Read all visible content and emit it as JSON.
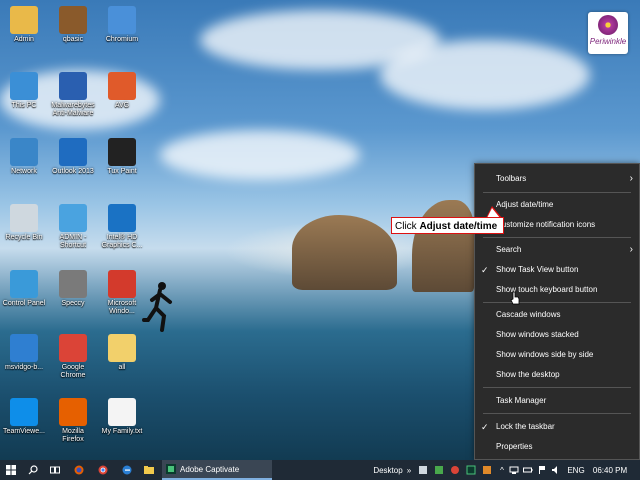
{
  "desktop_icons": [
    {
      "label": "Admin",
      "icon": "user-folder-icon",
      "color": "#e9b949"
    },
    {
      "label": "qbasic",
      "icon": "qbasic-icon",
      "color": "#8a5a2b"
    },
    {
      "label": "Chromium",
      "icon": "chromium-icon",
      "color": "#4a90d9"
    },
    {
      "label": "This PC",
      "icon": "computer-icon",
      "color": "#3b8fd6"
    },
    {
      "label": "Malwarebytes\nAnti-Malware",
      "icon": "malwarebytes-icon",
      "color": "#2a5fb0"
    },
    {
      "label": "AVG",
      "icon": "avg-icon",
      "color": "#e05a2a"
    },
    {
      "label": "Network",
      "icon": "network-icon",
      "color": "#3a86c8"
    },
    {
      "label": "Outlook 2013",
      "icon": "outlook-icon",
      "color": "#1f6cc0"
    },
    {
      "label": "Tux Paint",
      "icon": "tux-paint-icon",
      "color": "#222222"
    },
    {
      "label": "Recycle Bin",
      "icon": "recycle-bin-icon",
      "color": "#cfd8df"
    },
    {
      "label": "ADMIN -\nShortcut",
      "icon": "admin-shortcut-icon",
      "color": "#4aa3e0"
    },
    {
      "label": "Intel® HD\nGraphics C...",
      "icon": "intel-graphics-icon",
      "color": "#1a72c4"
    },
    {
      "label": "Control Panel",
      "icon": "control-panel-icon",
      "color": "#3a9ad9"
    },
    {
      "label": "Speccy",
      "icon": "speccy-icon",
      "color": "#7a7a7a"
    },
    {
      "label": "Microsoft\nWindo...",
      "icon": "microsoft-window-icon",
      "color": "#d33a2c"
    },
    {
      "label": "msvidgo-b...",
      "icon": "msvidgo-icon",
      "color": "#2f7fd1"
    },
    {
      "label": "Google\nChrome",
      "icon": "google-chrome-icon",
      "color": "#db4437"
    },
    {
      "label": "all",
      "icon": "folder-icon",
      "color": "#f2d06b"
    },
    {
      "label": "TeamViewe...",
      "icon": "teamviewer-icon",
      "color": "#0e8ee9"
    },
    {
      "label": "Mozilla\nFirefox",
      "icon": "firefox-icon",
      "color": "#e66000"
    },
    {
      "label": "My Family.txt",
      "icon": "text-file-icon",
      "color": "#f4f4f4"
    }
  ],
  "logo": {
    "name": "Periwinkle"
  },
  "context_menu": {
    "items": [
      {
        "label": "Toolbars",
        "submenu": true,
        "checked": false
      },
      {
        "label": "Adjust date/time",
        "submenu": false,
        "checked": false
      },
      {
        "label": "Customize notification icons",
        "submenu": false,
        "checked": false
      },
      {
        "label": "Search",
        "submenu": true,
        "checked": false
      },
      {
        "label": "Show Task View button",
        "submenu": false,
        "checked": true
      },
      {
        "label": "Show touch keyboard button",
        "submenu": false,
        "checked": false
      },
      {
        "label": "Cascade windows",
        "submenu": false,
        "checked": false
      },
      {
        "label": "Show windows stacked",
        "submenu": false,
        "checked": false
      },
      {
        "label": "Show windows side by side",
        "submenu": false,
        "checked": false
      },
      {
        "label": "Show the desktop",
        "submenu": false,
        "checked": false
      },
      {
        "label": "Task Manager",
        "submenu": false,
        "checked": false
      },
      {
        "label": "Lock the taskbar",
        "submenu": false,
        "checked": true
      },
      {
        "label": "Properties",
        "submenu": false,
        "checked": false
      }
    ]
  },
  "callout": {
    "prefix": "Click ",
    "bold": "Adjust date/time"
  },
  "taskbar": {
    "active_app": "Adobe Captivate",
    "desktop_label": "Desktop",
    "language": "ENG",
    "time": "06:40 PM"
  },
  "colors": {
    "taskbar": "#1f2a36",
    "menu_bg": "#2b2b2b",
    "callout_border": "#dd1111",
    "accent": "#7fb0e0"
  }
}
